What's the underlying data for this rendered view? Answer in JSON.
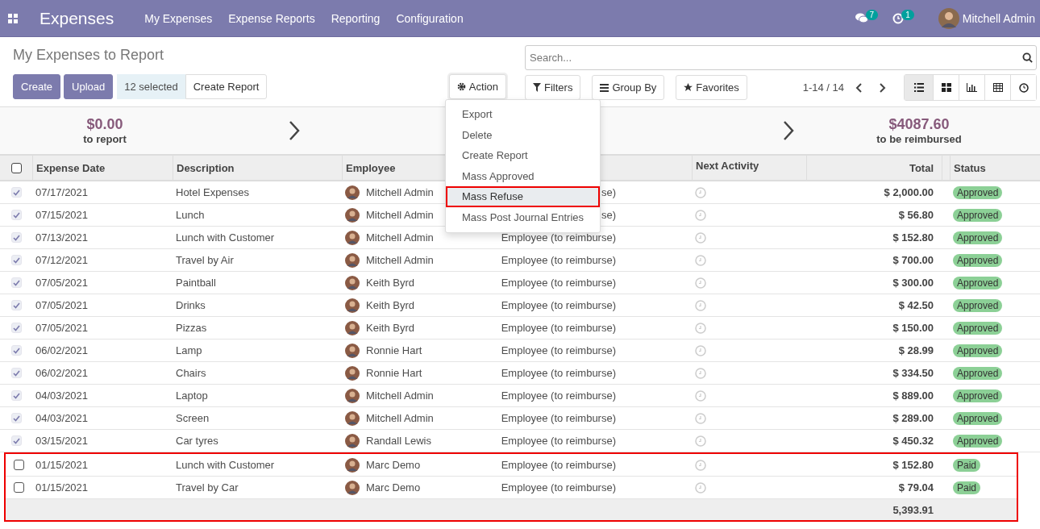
{
  "navbar": {
    "app": "Expenses",
    "menu": [
      "My Expenses",
      "Expense Reports",
      "Reporting",
      "Configuration"
    ],
    "messages_count": "7",
    "activities_count": "1",
    "user": "Mitchell Admin"
  },
  "breadcrumb": "My Expenses to Report",
  "buttons": {
    "create": "Create",
    "upload": "Upload",
    "selected": "12 selected",
    "create_report": "Create Report",
    "action": "Action"
  },
  "search": {
    "placeholder": "Search..."
  },
  "filters": [
    "Filters",
    "Group By",
    "Favorites"
  ],
  "pager": "1-14 / 14",
  "views": [
    {
      "kind": "list",
      "selected": true
    },
    {
      "kind": "kanban",
      "selected": false
    },
    {
      "kind": "graph",
      "selected": false
    },
    {
      "kind": "pivot",
      "selected": false
    },
    {
      "kind": "activity",
      "selected": false
    }
  ],
  "summary": [
    {
      "amount": "$0.00",
      "label": "to report"
    },
    {
      "amount": "$4087.60",
      "label": "to be reimbursed"
    }
  ],
  "action_menu": [
    {
      "label": "Export",
      "highlighted": false
    },
    {
      "label": "Delete",
      "highlighted": false
    },
    {
      "label": "Create Report",
      "highlighted": false
    },
    {
      "label": "Mass Approved",
      "highlighted": false
    },
    {
      "label": "Mass Refuse",
      "highlighted": true
    },
    {
      "label": "Mass Post Journal Entries",
      "highlighted": false
    }
  ],
  "table": {
    "all_checked": false,
    "columns": [
      "Expense Date",
      "Description",
      "Employee",
      "Next Activity",
      "Total",
      "Status"
    ],
    "rows": [
      {
        "checked": true,
        "highlighted": false,
        "date": "07/17/2021",
        "description": "Hotel Expenses",
        "employee": "Mitchell Admin",
        "paid_by": "se)",
        "total": "$ 2,000.00",
        "status": "Approved"
      },
      {
        "checked": true,
        "highlighted": false,
        "date": "07/15/2021",
        "description": "Lunch",
        "employee": "Mitchell Admin",
        "paid_by": "se)",
        "total": "$ 56.80",
        "status": "Approved"
      },
      {
        "checked": true,
        "highlighted": false,
        "date": "07/13/2021",
        "description": "Lunch with Customer",
        "employee": "Mitchell Admin",
        "paid_by": "Employee (to reimburse)",
        "total": "$ 152.80",
        "status": "Approved"
      },
      {
        "checked": true,
        "highlighted": false,
        "date": "07/12/2021",
        "description": "Travel by Air",
        "employee": "Mitchell Admin",
        "paid_by": "Employee (to reimburse)",
        "total": "$ 700.00",
        "status": "Approved"
      },
      {
        "checked": true,
        "highlighted": false,
        "date": "07/05/2021",
        "description": "Paintball",
        "employee": "Keith Byrd",
        "paid_by": "Employee (to reimburse)",
        "total": "$ 300.00",
        "status": "Approved"
      },
      {
        "checked": true,
        "highlighted": false,
        "date": "07/05/2021",
        "description": "Drinks",
        "employee": "Keith Byrd",
        "paid_by": "Employee (to reimburse)",
        "total": "$ 42.50",
        "status": "Approved"
      },
      {
        "checked": true,
        "highlighted": false,
        "date": "07/05/2021",
        "description": "Pizzas",
        "employee": "Keith Byrd",
        "paid_by": "Employee (to reimburse)",
        "total": "$ 150.00",
        "status": "Approved"
      },
      {
        "checked": true,
        "highlighted": false,
        "date": "06/02/2021",
        "description": "Lamp",
        "employee": "Ronnie Hart",
        "paid_by": "Employee (to reimburse)",
        "total": "$ 28.99",
        "status": "Approved"
      },
      {
        "checked": true,
        "highlighted": false,
        "date": "06/02/2021",
        "description": "Chairs",
        "employee": "Ronnie Hart",
        "paid_by": "Employee (to reimburse)",
        "total": "$ 334.50",
        "status": "Approved"
      },
      {
        "checked": true,
        "highlighted": false,
        "date": "04/03/2021",
        "description": "Laptop",
        "employee": "Mitchell Admin",
        "paid_by": "Employee (to reimburse)",
        "total": "$ 889.00",
        "status": "Approved"
      },
      {
        "checked": true,
        "highlighted": false,
        "date": "04/03/2021",
        "description": "Screen",
        "employee": "Mitchell Admin",
        "paid_by": "Employee (to reimburse)",
        "total": "$ 289.00",
        "status": "Approved"
      },
      {
        "checked": true,
        "highlighted": false,
        "date": "03/15/2021",
        "description": "Car tyres",
        "employee": "Randall Lewis",
        "paid_by": "Employee (to reimburse)",
        "total": "$ 450.32",
        "status": "Approved"
      },
      {
        "checked": false,
        "highlighted": true,
        "date": "01/15/2021",
        "description": "Lunch with Customer",
        "employee": "Marc Demo",
        "paid_by": "Employee (to reimburse)",
        "total": "$ 152.80",
        "status": "Paid"
      },
      {
        "checked": false,
        "highlighted": true,
        "date": "01/15/2021",
        "description": "Travel by Car",
        "employee": "Marc Demo",
        "paid_by": "Employee (to reimburse)",
        "total": "$ 79.04",
        "status": "Paid"
      }
    ],
    "sum": "5,393.91"
  }
}
